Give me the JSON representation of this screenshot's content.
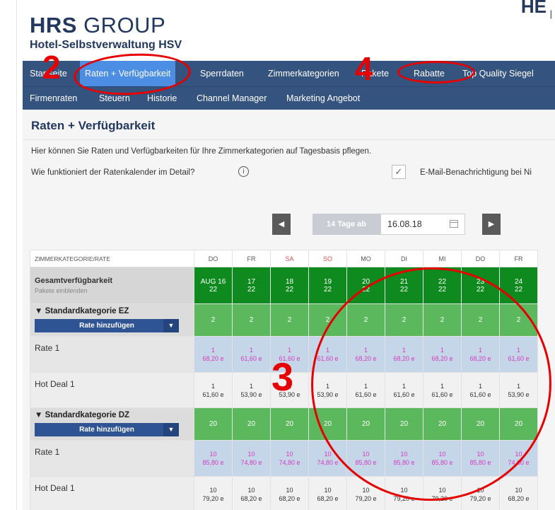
{
  "brand": {
    "name_bold": "HRS",
    "name_light": " GROUP",
    "subtitle": "Hotel-Selbstverwaltung HSV",
    "corner_mark": "HE"
  },
  "nav_primary": [
    {
      "label": "Startseite",
      "active": false
    },
    {
      "label": "Raten + Verfügbarkeit",
      "active": true
    },
    {
      "label": "Sperrdaten",
      "active": false
    },
    {
      "label": "Zimmerkategorien",
      "active": false
    },
    {
      "label": "Pakete",
      "active": false
    },
    {
      "label": "Rabatte",
      "active": false
    },
    {
      "label": "Top Quality Siegel",
      "active": false
    }
  ],
  "nav_secondary": [
    {
      "label": "Firmenraten"
    },
    {
      "label": "Steuern"
    },
    {
      "label": "Historie"
    },
    {
      "label": "Channel Manager"
    },
    {
      "label": "Marketing Angebot"
    }
  ],
  "page": {
    "title": "Raten + Verfügbarkeit",
    "intro": "Hier können Sie Raten und Verfügbarkeiten für Ihre Zimmerkategorien auf Tagesbasis pflegen.",
    "help_link": "Wie funktioniert der Ratenkalender im Detail?",
    "email_label": "E-Mail-Benachrichtigung bei Ni",
    "email_checked": true
  },
  "date_nav": {
    "days_label": "14 Tage ab",
    "start_date": "16.08.18",
    "prev_icon": "chevron-left-icon",
    "next_icon": "chevron-right-icon"
  },
  "grid": {
    "header_first": "ZIMMERKATEGORIE/RATE",
    "days": [
      {
        "wd": "DO",
        "weekend": false,
        "date": "AUG 16"
      },
      {
        "wd": "FR",
        "weekend": false,
        "date": "17"
      },
      {
        "wd": "SA",
        "weekend": true,
        "date": "18"
      },
      {
        "wd": "SO",
        "weekend": true,
        "date": "19"
      },
      {
        "wd": "MO",
        "weekend": false,
        "date": "20"
      },
      {
        "wd": "DI",
        "weekend": false,
        "date": "21"
      },
      {
        "wd": "MI",
        "weekend": false,
        "date": "22"
      },
      {
        "wd": "DO",
        "weekend": false,
        "date": "23"
      },
      {
        "wd": "FR",
        "weekend": false,
        "date": "24"
      }
    ],
    "total": {
      "label": "Gesamtverfügbarkeit",
      "sub": "Pakete einblenden",
      "values": [
        "22",
        "22",
        "22",
        "22",
        "22",
        "22",
        "22",
        "22",
        "22"
      ]
    },
    "categories": [
      {
        "name": "▼ Standardkategorie EZ",
        "add_label": "Rate hinzufügen",
        "availability": [
          "2",
          "2",
          "2",
          "2",
          "2",
          "2",
          "2",
          "2",
          "2"
        ],
        "rates": [
          {
            "name": "Rate 1",
            "kind": "rate",
            "qty": [
              "1",
              "1",
              "1",
              "1",
              "1",
              "1",
              "1",
              "1",
              "1"
            ],
            "price": [
              "68,20 e",
              "61,60 e",
              "61,60 e",
              "61,60 e",
              "68,20 e",
              "68,20 e",
              "68,20 e",
              "68,20 e",
              "61,60 e"
            ]
          },
          {
            "name": "Hot Deal 1",
            "kind": "deal",
            "qty": [
              "1",
              "1",
              "1",
              "1",
              "1",
              "1",
              "1",
              "1",
              "1"
            ],
            "price": [
              "61,60 e",
              "53,90 e",
              "53,90 e",
              "53,90 e",
              "61,60 e",
              "61,60 e",
              "61,60 e",
              "61,60 e",
              "53,90 e"
            ]
          }
        ]
      },
      {
        "name": "▼ Standardkategorie DZ",
        "add_label": "Rate hinzufügen",
        "availability": [
          "20",
          "20",
          "20",
          "20",
          "20",
          "20",
          "20",
          "20",
          "20"
        ],
        "rates": [
          {
            "name": "Rate 1",
            "kind": "rate",
            "qty": [
              "10",
              "10",
              "10",
              "10",
              "10",
              "10",
              "10",
              "10",
              "10"
            ],
            "price": [
              "85,80 e",
              "74,80 e",
              "74,80 e",
              "74,80 e",
              "85,80 e",
              "85,80 e",
              "85,80 e",
              "85,80 e",
              "74,80 e"
            ]
          },
          {
            "name": "Hot Deal 1",
            "kind": "deal",
            "qty": [
              "10",
              "10",
              "10",
              "10",
              "10",
              "10",
              "10",
              "10",
              "10"
            ],
            "price": [
              "79,20 e",
              "68,20 e",
              "68,20 e",
              "68,20 e",
              "79,20 e",
              "79,20 e",
              "79,20 e",
              "79,20 e",
              "68,20 e"
            ]
          }
        ]
      }
    ]
  },
  "annotations": {
    "n2": "2",
    "n3": "3",
    "n4": "4",
    "color": "#e60000"
  }
}
